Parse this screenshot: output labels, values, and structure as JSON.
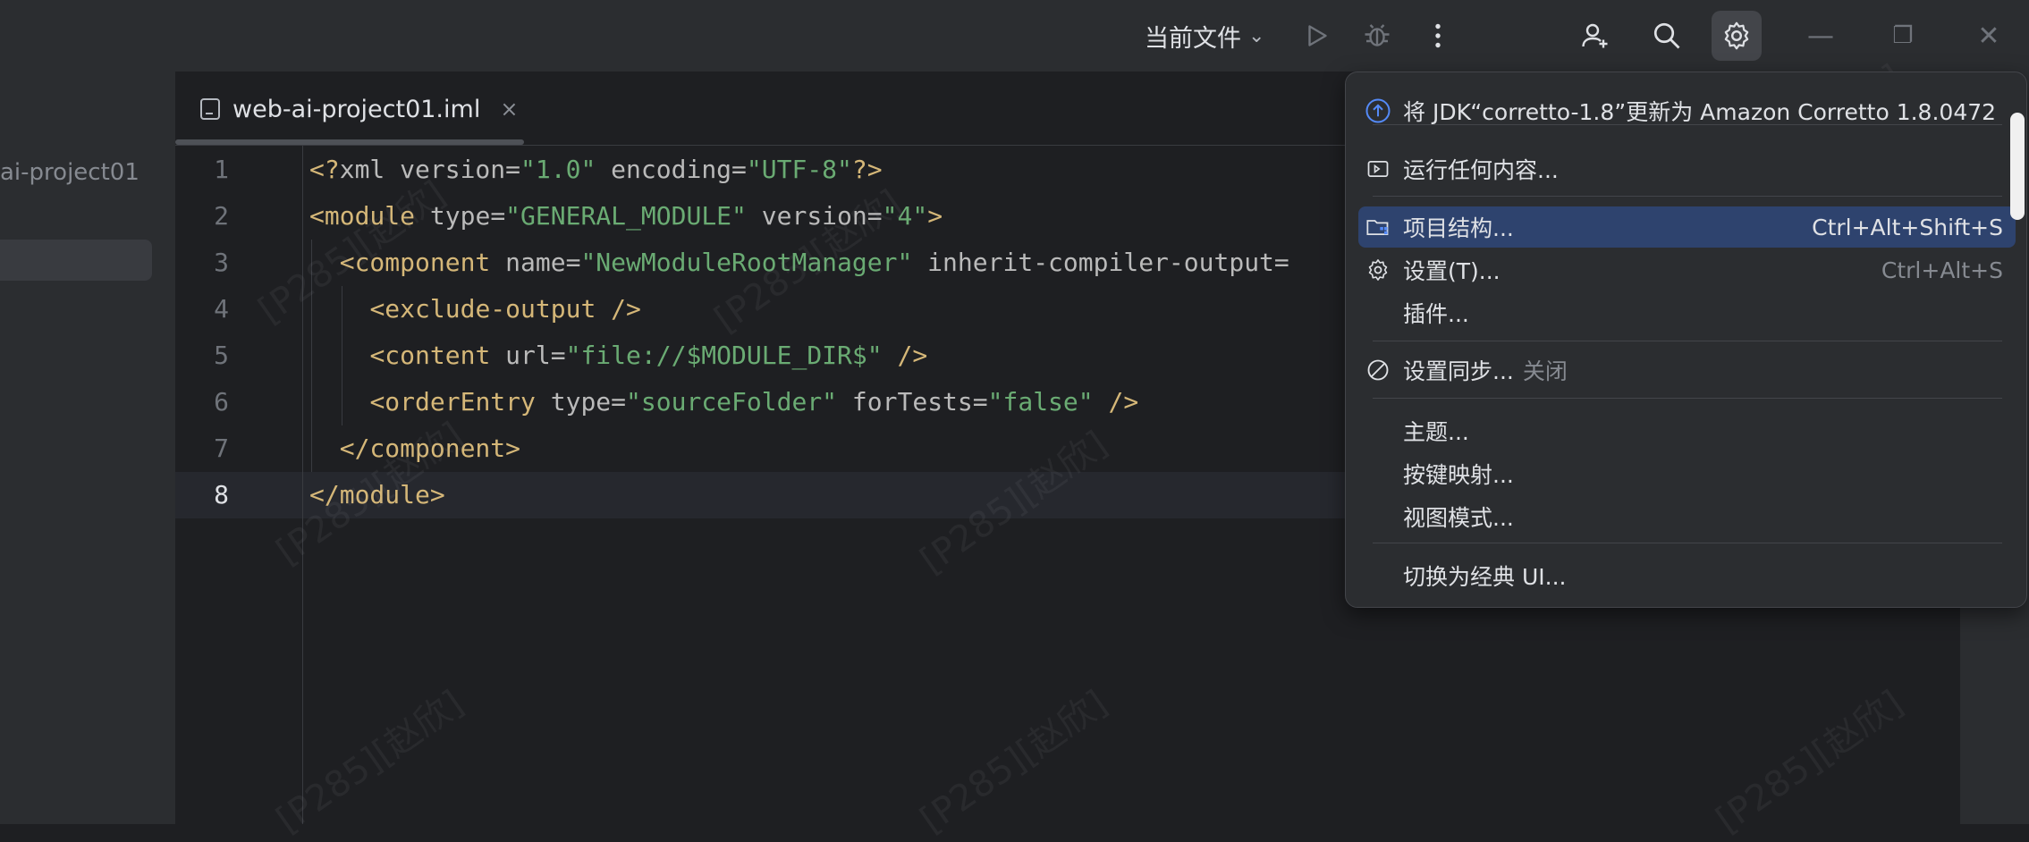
{
  "toolbar": {
    "run_config_label": "当前文件",
    "icons": [
      "run-icon",
      "debug-icon",
      "more-vertical-icon",
      "add-user-icon",
      "search-icon",
      "gear-icon"
    ]
  },
  "window_controls": {
    "minimize": "—",
    "restore": "❐",
    "close": "✕"
  },
  "left_panel": {
    "project_name": "ai-project01"
  },
  "editor": {
    "tab": {
      "label": "web-ai-project01.iml",
      "close": "×"
    },
    "current_line": 8,
    "lines": [
      {
        "n": "1",
        "tokens": [
          {
            "c": "p",
            "t": "<?"
          },
          {
            "c": "a",
            "t": "xml version"
          },
          {
            "c": "a",
            "t": "="
          },
          {
            "c": "v",
            "t": "\"1.0\""
          },
          {
            "c": "a",
            "t": " encoding"
          },
          {
            "c": "a",
            "t": "="
          },
          {
            "c": "v",
            "t": "\"UTF-8\""
          },
          {
            "c": "p",
            "t": "?>"
          }
        ]
      },
      {
        "n": "2",
        "tokens": [
          {
            "c": "t",
            "t": "<module"
          },
          {
            "c": "a",
            "t": " type"
          },
          {
            "c": "a",
            "t": "="
          },
          {
            "c": "v",
            "t": "\"GENERAL_MODULE\""
          },
          {
            "c": "a",
            "t": " version"
          },
          {
            "c": "a",
            "t": "="
          },
          {
            "c": "v",
            "t": "\"4\""
          },
          {
            "c": "t",
            "t": ">"
          }
        ]
      },
      {
        "n": "3",
        "indent": "  ",
        "tokens": [
          {
            "c": "t",
            "t": "<component"
          },
          {
            "c": "a",
            "t": " name"
          },
          {
            "c": "a",
            "t": "="
          },
          {
            "c": "v",
            "t": "\"NewModuleRootManager\""
          },
          {
            "c": "a",
            "t": " inherit-compiler-output"
          },
          {
            "c": "a",
            "t": "="
          }
        ]
      },
      {
        "n": "4",
        "indent": "    ",
        "tokens": [
          {
            "c": "t",
            "t": "<exclude-output"
          },
          {
            "c": "t",
            "t": " />"
          }
        ]
      },
      {
        "n": "5",
        "indent": "    ",
        "tokens": [
          {
            "c": "t",
            "t": "<content"
          },
          {
            "c": "a",
            "t": " url"
          },
          {
            "c": "a",
            "t": "="
          },
          {
            "c": "v",
            "t": "\"file://$MODULE_DIR$\""
          },
          {
            "c": "t",
            "t": " />"
          }
        ]
      },
      {
        "n": "6",
        "indent": "    ",
        "tokens": [
          {
            "c": "t",
            "t": "<orderEntry"
          },
          {
            "c": "a",
            "t": " type"
          },
          {
            "c": "a",
            "t": "="
          },
          {
            "c": "v",
            "t": "\"sourceFolder\""
          },
          {
            "c": "a",
            "t": " forTests"
          },
          {
            "c": "a",
            "t": "="
          },
          {
            "c": "v",
            "t": "\"false\""
          },
          {
            "c": "t",
            "t": " />"
          }
        ]
      },
      {
        "n": "7",
        "indent": "  ",
        "tokens": [
          {
            "c": "t",
            "t": "</component>"
          }
        ]
      },
      {
        "n": "8",
        "tokens": [
          {
            "c": "t",
            "t": "</module>"
          }
        ]
      }
    ]
  },
  "watermark_text": "[P285][赵欣]",
  "settings_menu": {
    "items": [
      {
        "id": "update-jdk",
        "icon": "update-arrow-icon",
        "label": "将 JDK“corretto-1.8”更新为 Amazon Corretto 1.8.0472",
        "shortcut": ""
      },
      {
        "id": "run-anything",
        "icon": "run-anything-icon",
        "label": "运行任何内容...",
        "shortcut": ""
      },
      {
        "id": "project-structure",
        "icon": "project-structure-icon",
        "label": "项目结构...",
        "shortcut": "Ctrl+Alt+Shift+S",
        "selected": true
      },
      {
        "id": "settings",
        "icon": "gear-icon",
        "label": "设置(T)...",
        "shortcut": "Ctrl+Alt+S"
      },
      {
        "id": "plugins",
        "icon": "",
        "label": "插件...",
        "shortcut": ""
      },
      {
        "id": "settings-sync",
        "icon": "sync-disabled-icon",
        "label": "设置同步...",
        "suffix": "关闭",
        "shortcut": ""
      },
      {
        "id": "theme",
        "icon": "",
        "label": "主题...",
        "shortcut": ""
      },
      {
        "id": "keymap",
        "icon": "",
        "label": "按键映射...",
        "shortcut": ""
      },
      {
        "id": "view-mode",
        "icon": "",
        "label": "视图模式...",
        "shortcut": ""
      },
      {
        "id": "switch-classic-ui",
        "icon": "",
        "label": "切换为经典 UI...",
        "shortcut": ""
      }
    ]
  }
}
